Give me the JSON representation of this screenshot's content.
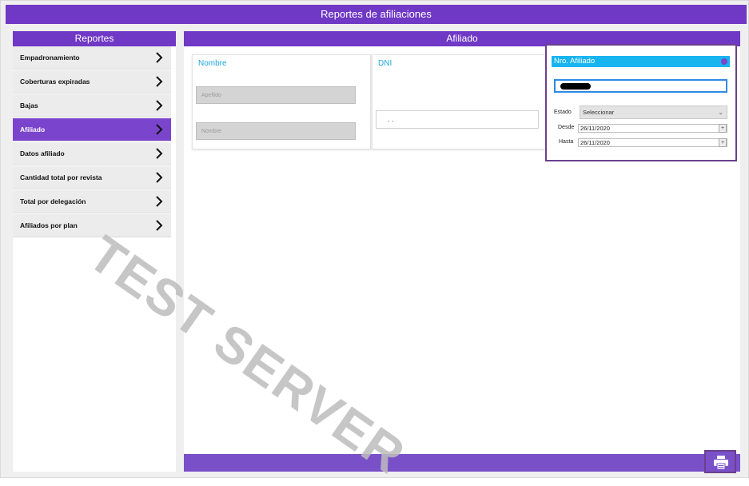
{
  "header": {
    "title": "Reportes de afiliaciones"
  },
  "sidebar": {
    "title": "Reportes",
    "items": [
      {
        "label": "Empadronamiento"
      },
      {
        "label": "Coberturas expiradas"
      },
      {
        "label": "Bajas"
      },
      {
        "label": "Afiliado"
      },
      {
        "label": "Datos afiliado"
      },
      {
        "label": "Cantidad total por revista"
      },
      {
        "label": "Total por delegación"
      },
      {
        "label": "Afiliados por plan"
      }
    ],
    "active_index": 3
  },
  "main": {
    "title": "Afiliado",
    "nombre_card": {
      "title": "Nombre",
      "apellido_placeholder": "Apellido",
      "nombre_placeholder": "Nombre"
    },
    "dni_card": {
      "title": "DNI",
      "value": ". ."
    },
    "nro_card": {
      "title": "Nro. Afiliado",
      "estado_label": "Estado",
      "estado_value": "Seleccionar",
      "desde_label": "Desde",
      "desde_value": "26/11/2020",
      "hasta_label": "Hasta",
      "hasta_value": "26/11/2020",
      "add_symbol": "+"
    }
  },
  "watermark": "TEST SERVER",
  "colors": {
    "primary": "#6f38c5",
    "accent": "#17b4f0",
    "highlight": "#6b3f8e"
  },
  "icons": {
    "chevron": "chevron-right-icon",
    "print": "print-icon"
  }
}
